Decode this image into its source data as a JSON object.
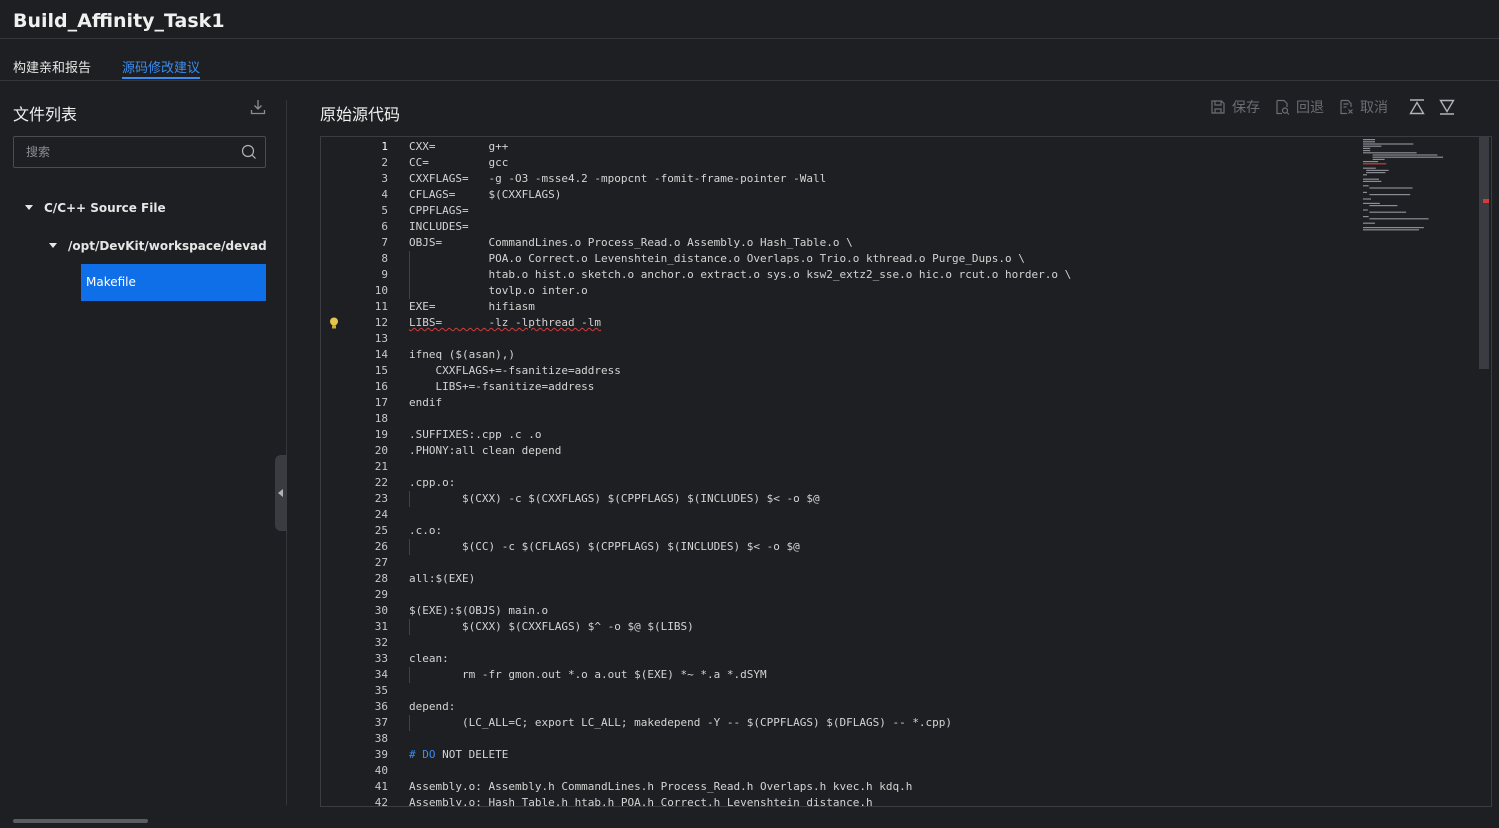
{
  "title": "Build_Affinity_Task1",
  "tabs": [
    {
      "label": "构建亲和报告",
      "active": false
    },
    {
      "label": "源码修改建议",
      "active": true
    }
  ],
  "left": {
    "header": "文件列表",
    "search_placeholder": "搜索",
    "tree": [
      {
        "label": "C/C++ Source File"
      },
      {
        "label": "/opt/DevKit/workspace/devadmin/"
      }
    ],
    "selected_file": "Makefile"
  },
  "right": {
    "header": "原始源代码",
    "toolbar": {
      "save": "保存",
      "revert": "回退",
      "cancel": "取消"
    }
  },
  "colors": {
    "accent": "#3c8cf0",
    "selected": "#0f6fe8",
    "error": "#d33b3b"
  },
  "code_lines": [
    "CXX=        g++",
    "CC=         gcc",
    "CXXFLAGS=   -g -O3 -msse4.2 -mpopcnt -fomit-frame-pointer -Wall",
    "CFLAGS=     $(CXXFLAGS)",
    "CPPFLAGS=",
    "INCLUDES=",
    "OBJS=       CommandLines.o Process_Read.o Assembly.o Hash_Table.o \\",
    "            POA.o Correct.o Levenshtein_distance.o Overlaps.o Trio.o kthread.o Purge_Dups.o \\",
    "            htab.o hist.o sketch.o anchor.o extract.o sys.o ksw2_extz2_sse.o hic.o rcut.o horder.o \\",
    "            tovlp.o inter.o",
    "EXE=        hifiasm",
    "LIBS=       -lz -lpthread -lm",
    "",
    "ifneq ($(asan),)",
    "    CXXFLAGS+=-fsanitize=address",
    "    LIBS+=-fsanitize=address",
    "endif",
    "",
    ".SUFFIXES:.cpp .c .o",
    ".PHONY:all clean depend",
    "",
    ".cpp.o:",
    "        $(CXX) -c $(CXXFLAGS) $(CPPFLAGS) $(INCLUDES) $< -o $@",
    "",
    ".c.o:",
    "        $(CC) -c $(CFLAGS) $(CPPFLAGS) $(INCLUDES) $< -o $@",
    "",
    "all:$(EXE)",
    "",
    "$(EXE):$(OBJS) main.o",
    "        $(CXX) $(CXXFLAGS) $^ -o $@ $(LIBS)",
    "",
    "clean:",
    "        rm -fr gmon.out *.o a.out $(EXE) *~ *.a *.dSYM",
    "",
    "depend:",
    "        (LC_ALL=C; export LC_ALL; makedepend -Y -- $(CPPFLAGS) $(DFLAGS) -- *.cpp)",
    "",
    "# DO NOT DELETE",
    "",
    "Assembly.o: Assembly.h CommandLines.h Process_Read.h Overlaps.h kvec.h kdq.h",
    "Assembly.o: Hash_Table.h htab.h POA.h Correct.h Levenshtein_distance.h"
  ]
}
